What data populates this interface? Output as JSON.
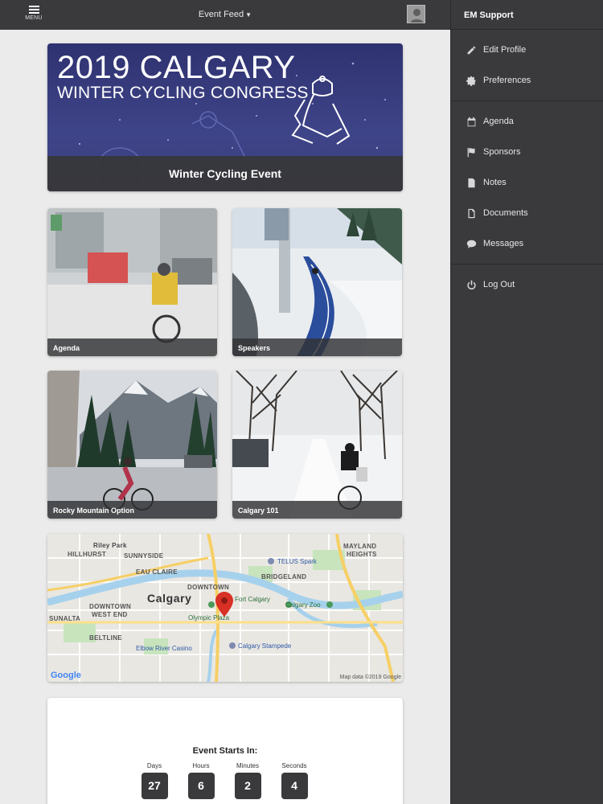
{
  "topbar": {
    "menu_label": "MENU",
    "feed_title": "Event Feed"
  },
  "sidebar": {
    "header": "EM Support",
    "groups": [
      {
        "items": [
          {
            "label": "Edit Profile",
            "icon": "pencil-icon"
          },
          {
            "label": "Preferences",
            "icon": "gear-icon"
          }
        ]
      },
      {
        "items": [
          {
            "label": "Agenda",
            "icon": "calendar-icon"
          },
          {
            "label": "Sponsors",
            "icon": "flag-icon"
          },
          {
            "label": "Notes",
            "icon": "note-icon"
          },
          {
            "label": "Documents",
            "icon": "document-icon"
          },
          {
            "label": "Messages",
            "icon": "chat-icon"
          }
        ]
      },
      {
        "items": [
          {
            "label": "Log Out",
            "icon": "power-icon"
          }
        ]
      }
    ]
  },
  "hero": {
    "line1": "2019 CALGARY",
    "line2": "WINTER CYCLING CONGRESS",
    "caption": "Winter Cycling Event"
  },
  "tiles": [
    {
      "caption": "Agenda"
    },
    {
      "caption": "Speakers"
    },
    {
      "caption": "Rocky Mountain Option"
    },
    {
      "caption": "Calgary 101"
    }
  ],
  "map": {
    "city": "Calgary",
    "labels": [
      "Riley Park",
      "HILLHURST",
      "SUNNYSIDE",
      "EAU CLAIRE",
      "DOWNTOWN",
      "BRIDGELAND",
      "MAYLAND",
      "HEIGHTS",
      "SUNALTA",
      "DOWNTOWN",
      "WEST END",
      "BELTLINE"
    ],
    "pois": [
      "TELUS Spark",
      "Fort Calgary",
      "Calgary Zoo",
      "Olympic Plaza",
      "Elbow River Casino",
      "Calgary Stampede"
    ],
    "attribution": "Map data ©2019 Google",
    "google": "Google"
  },
  "countdown": {
    "title": "Event Starts In:",
    "units": [
      {
        "label": "Days",
        "value": "27"
      },
      {
        "label": "Hours",
        "value": "6"
      },
      {
        "label": "Minutes",
        "value": "2"
      },
      {
        "label": "Seconds",
        "value": "4"
      }
    ]
  },
  "colors": {
    "bar": "#3a393c",
    "hero": "#3e4488",
    "pin": "#d93025"
  }
}
